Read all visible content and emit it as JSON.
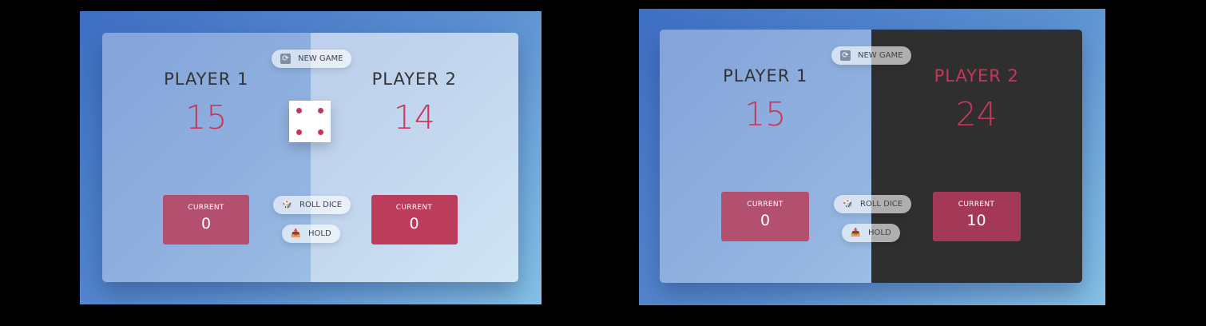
{
  "colors": {
    "background": "#3f6fc4",
    "accent": "#c7375a",
    "active_panel_dark": "#2f2f2f"
  },
  "screens": [
    {
      "new_game_label": "NEW GAME",
      "roll_label": "ROLL DICE",
      "hold_label": "HOLD",
      "dice_value": 4,
      "players": [
        {
          "name": "PLAYER 1",
          "score": "15",
          "current_label": "CURRENT",
          "current": "0",
          "state": "inactive"
        },
        {
          "name": "PLAYER 2",
          "score": "14",
          "current_label": "CURRENT",
          "current": "0",
          "state": "active"
        }
      ],
      "icons": {
        "new_game": "refresh-icon",
        "roll": "dice-icon",
        "hold": "inbox-download-icon"
      }
    },
    {
      "new_game_label": "NEW GAME",
      "roll_label": "ROLL DICE",
      "hold_label": "HOLD",
      "dice_value": null,
      "players": [
        {
          "name": "PLAYER 1",
          "score": "15",
          "current_label": "CURRENT",
          "current": "0",
          "state": "inactive"
        },
        {
          "name": "PLAYER 2",
          "score": "24",
          "current_label": "CURRENT",
          "current": "10",
          "state": "winner"
        }
      ],
      "icons": {
        "new_game": "refresh-icon",
        "roll": "dice-icon",
        "hold": "inbox-download-icon"
      }
    }
  ]
}
